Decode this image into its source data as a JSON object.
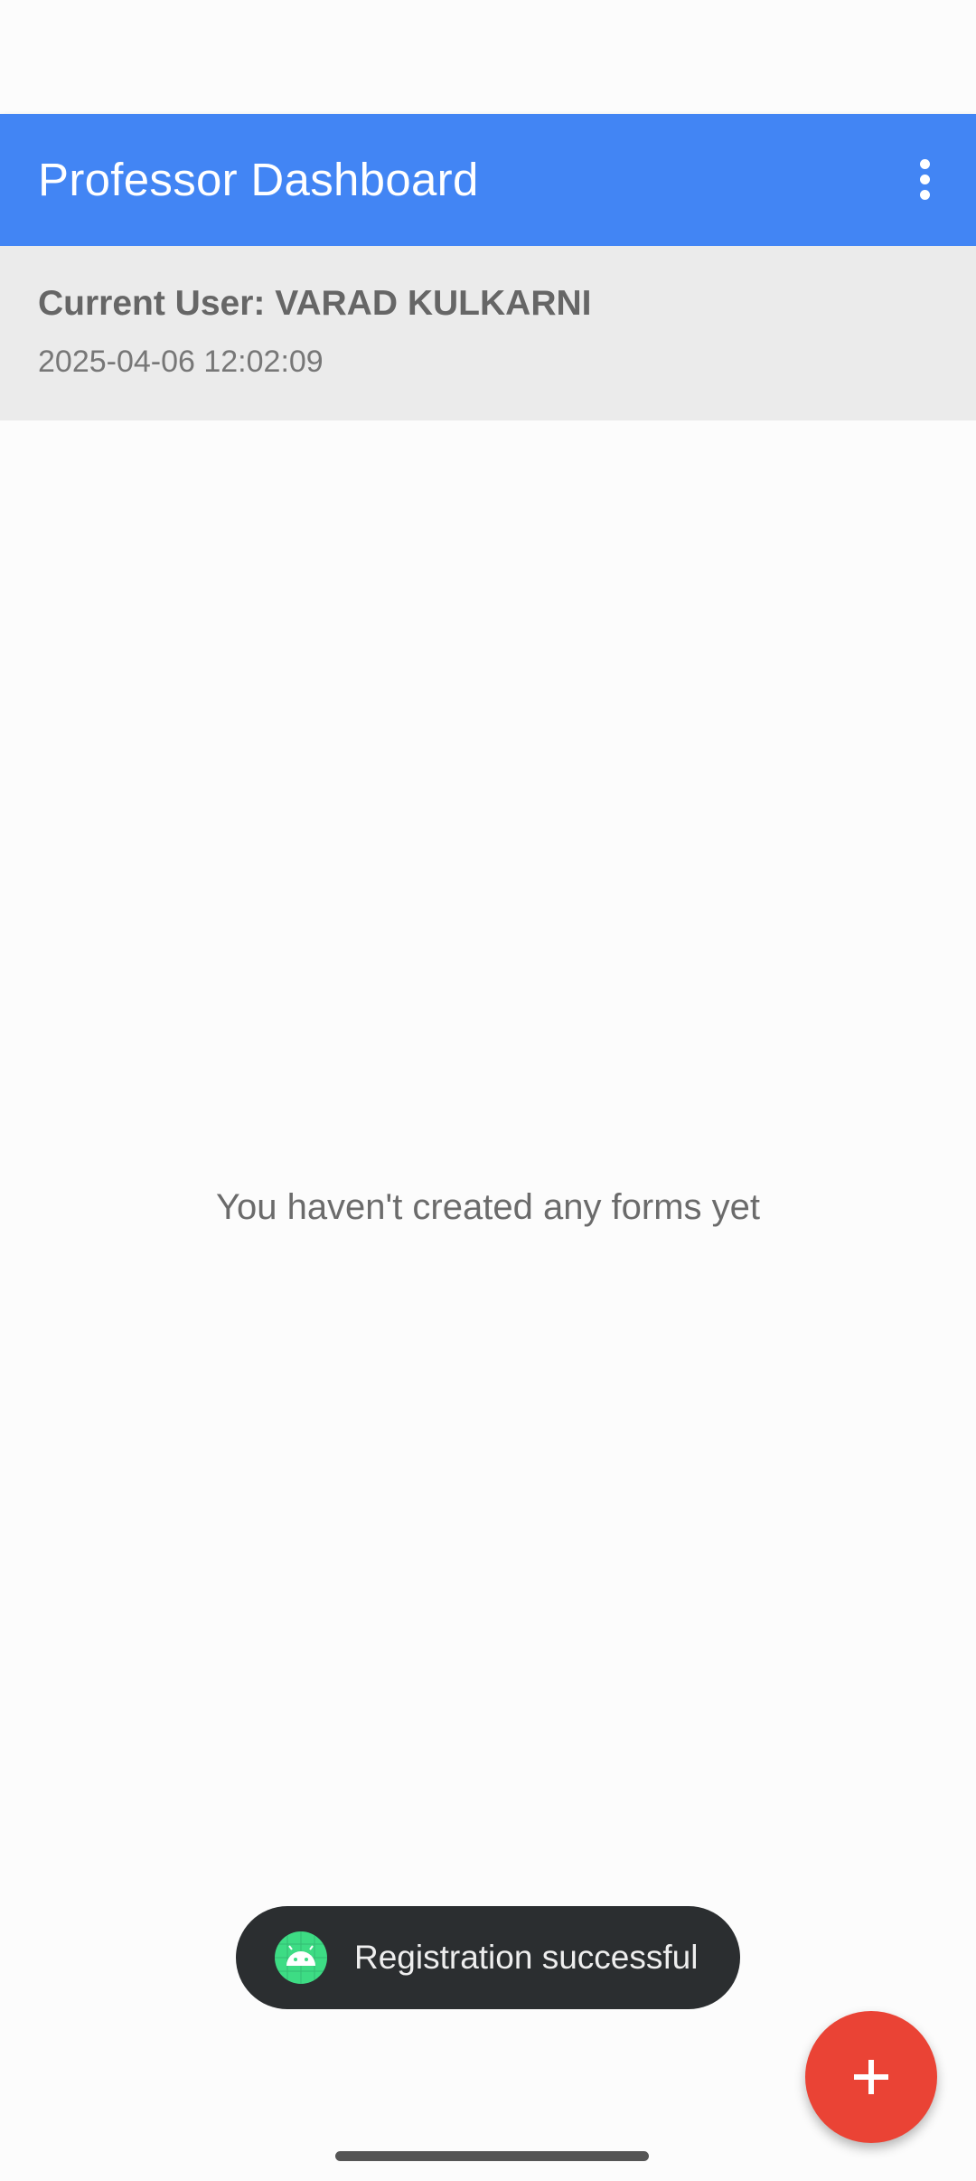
{
  "app_bar": {
    "title": "Professor Dashboard",
    "background": "#4285f4",
    "menu_icon": "more-vert-icon"
  },
  "user_panel": {
    "current_user": "Current User: VARAD KULKARNI",
    "datetime": "2025-04-06 12:02:09"
  },
  "main": {
    "empty_message": "You haven't created any forms yet"
  },
  "toast": {
    "icon": "android-icon",
    "message": "Registration successful"
  },
  "fab": {
    "icon": "plus-icon",
    "color": "#ea4335"
  }
}
